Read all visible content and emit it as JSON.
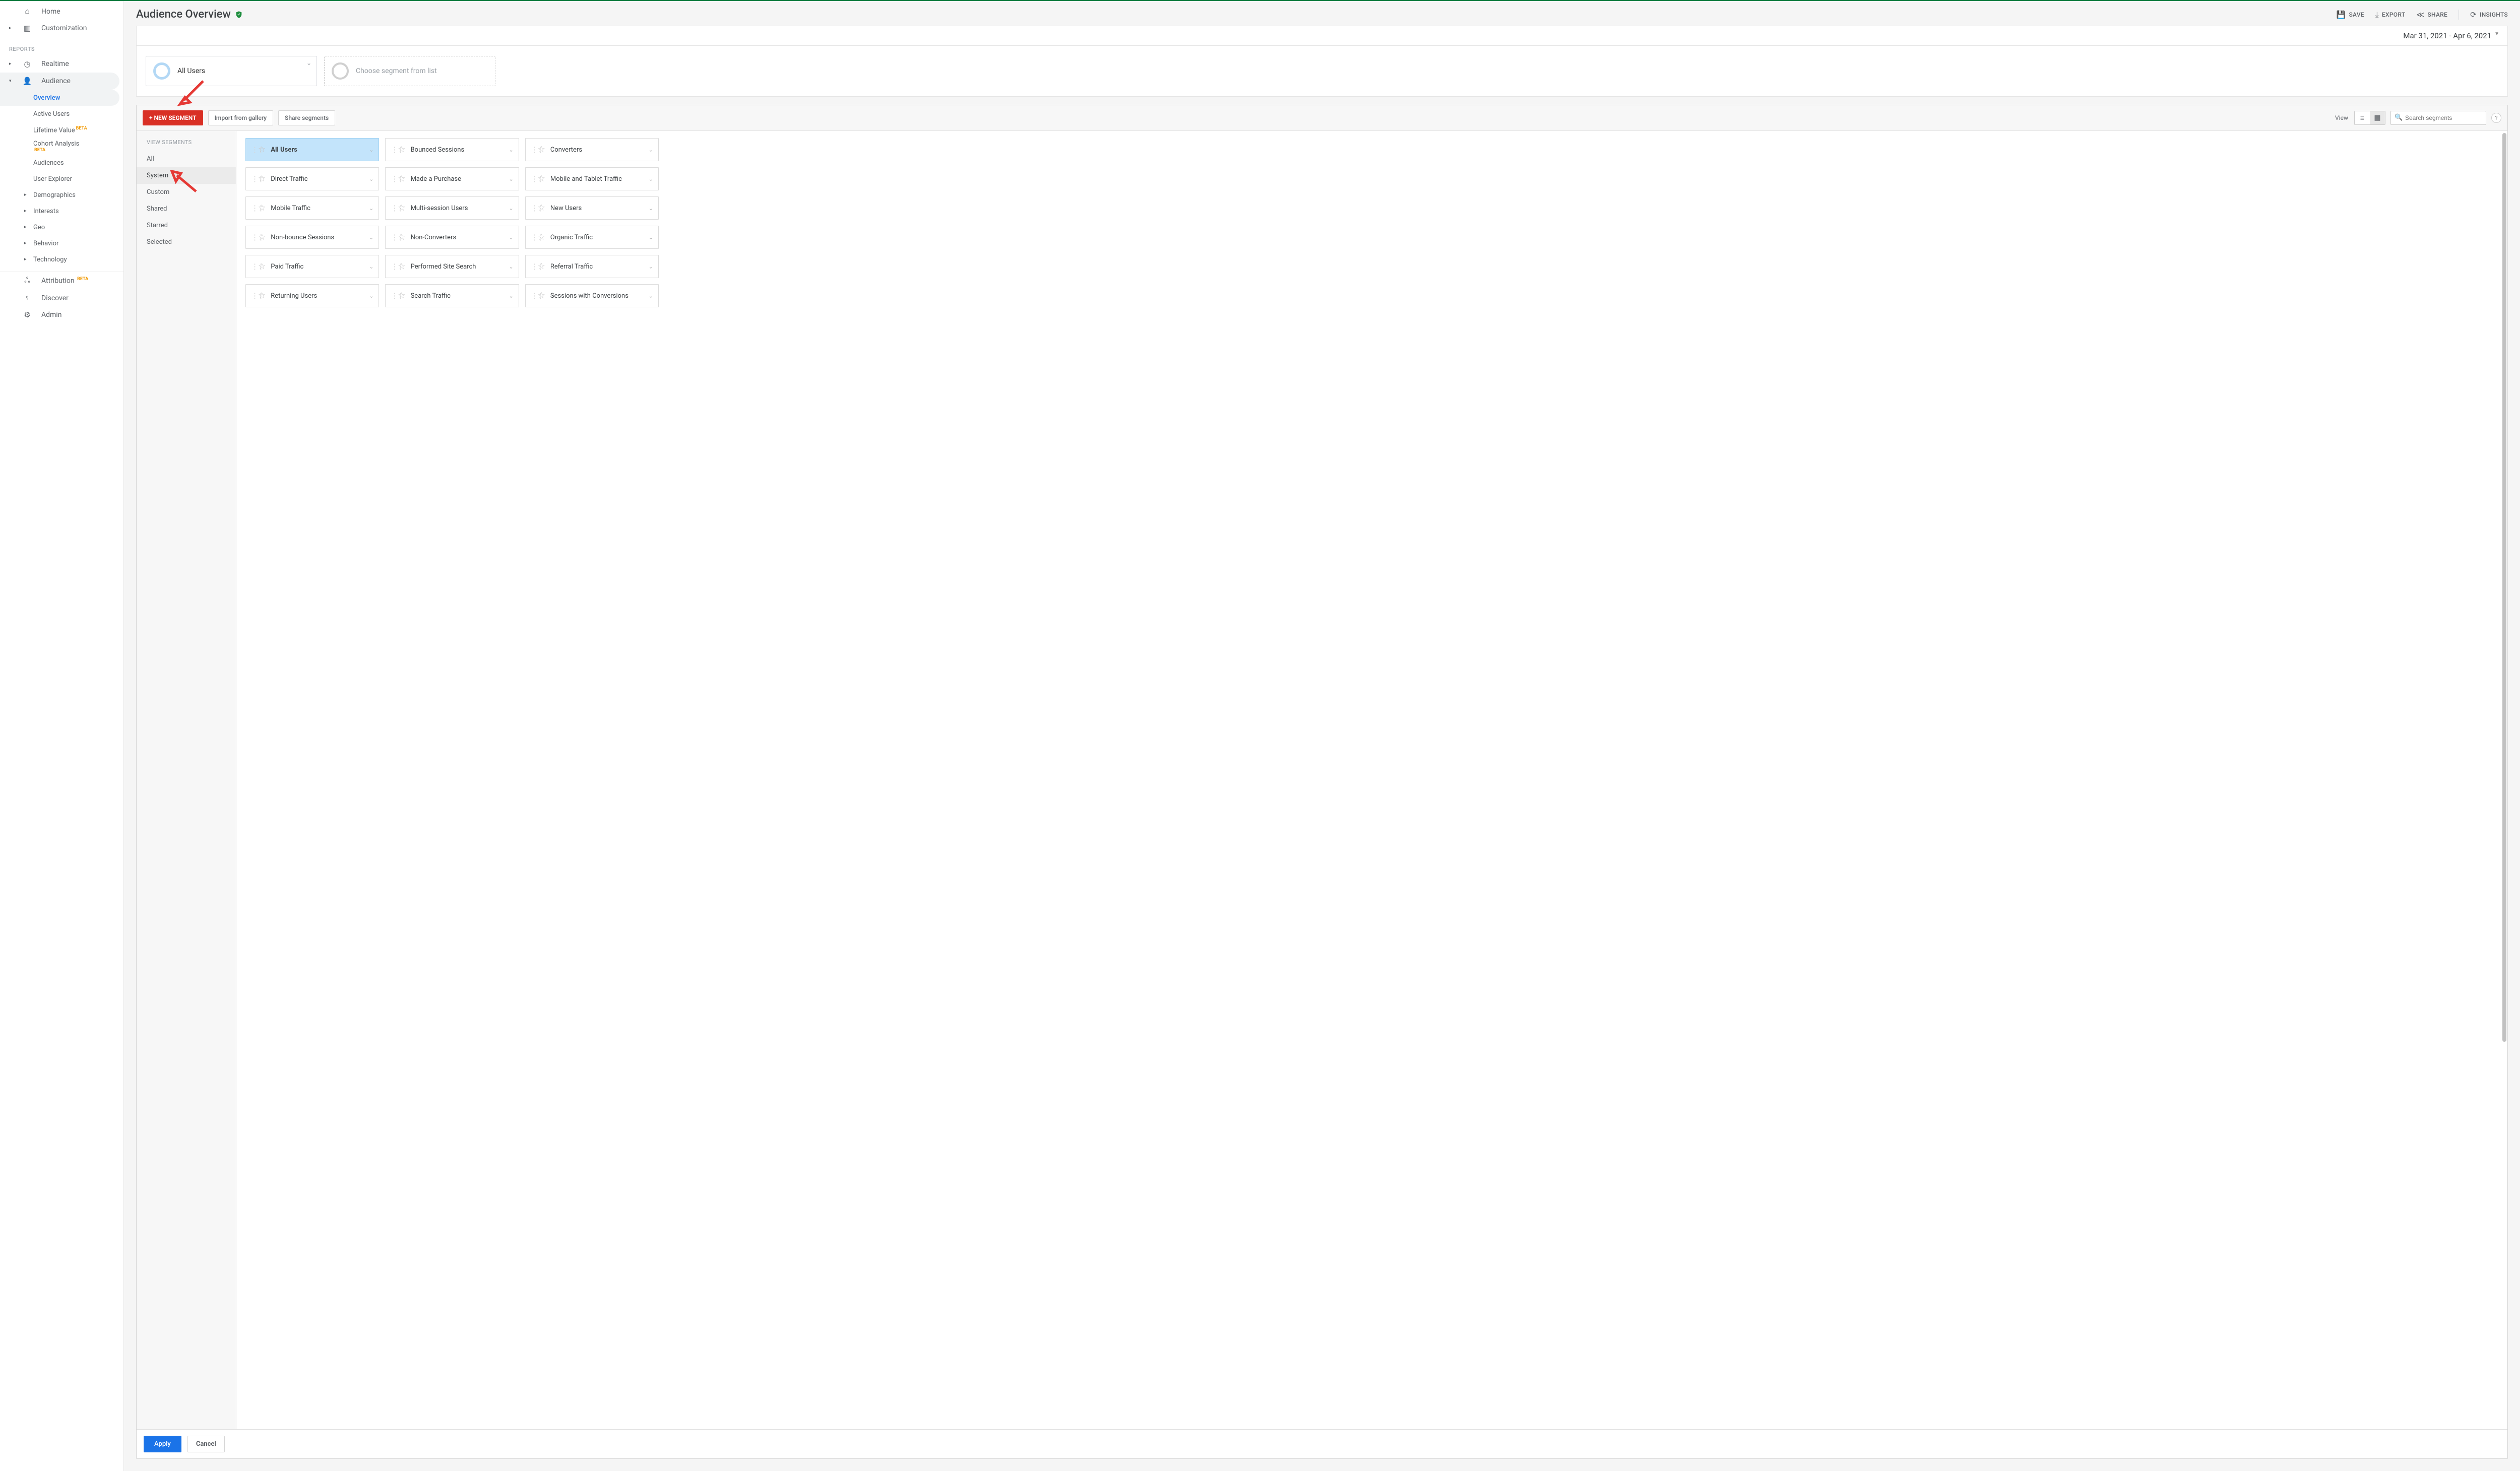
{
  "sidebar": {
    "home": "Home",
    "customization": "Customization",
    "reports_label": "REPORTS",
    "realtime": "Realtime",
    "audience": "Audience",
    "audience_sub": {
      "overview": "Overview",
      "active_users": "Active Users",
      "lifetime_value": "Lifetime Value",
      "cohort_analysis": "Cohort Analysis",
      "audiences": "Audiences",
      "user_explorer": "User Explorer",
      "demographics": "Demographics",
      "interests": "Interests",
      "geo": "Geo",
      "behavior": "Behavior",
      "technology": "Technology"
    },
    "attribution": "Attribution",
    "discover": "Discover",
    "admin": "Admin",
    "beta": "BETA"
  },
  "top": {
    "title": "Audience Overview",
    "save": "SAVE",
    "export": "EXPORT",
    "share": "SHARE",
    "insights": "INSIGHTS",
    "date_range": "Mar 31, 2021 - Apr 6, 2021"
  },
  "segments_preview": {
    "all_users": "All Users",
    "choose": "Choose segment from list"
  },
  "panel": {
    "new_segment": "+ NEW SEGMENT",
    "import": "Import from gallery",
    "share": "Share segments",
    "view_label": "View",
    "search_placeholder": "Search segments",
    "left_title": "VIEW SEGMENTS",
    "left_items": {
      "all": "All",
      "system": "System",
      "custom": "Custom",
      "shared": "Shared",
      "starred": "Starred",
      "selected": "Selected"
    },
    "tiles": [
      "All Users",
      "Bounced Sessions",
      "Converters",
      "Direct Traffic",
      "Made a Purchase",
      "Mobile and Tablet Traffic",
      "Mobile Traffic",
      "Multi-session Users",
      "New Users",
      "Non-bounce Sessions",
      "Non-Converters",
      "Organic Traffic",
      "Paid Traffic",
      "Performed Site Search",
      "Referral Traffic",
      "Returning Users",
      "Search Traffic",
      "Sessions with Conversions"
    ],
    "apply": "Apply",
    "cancel": "Cancel"
  }
}
